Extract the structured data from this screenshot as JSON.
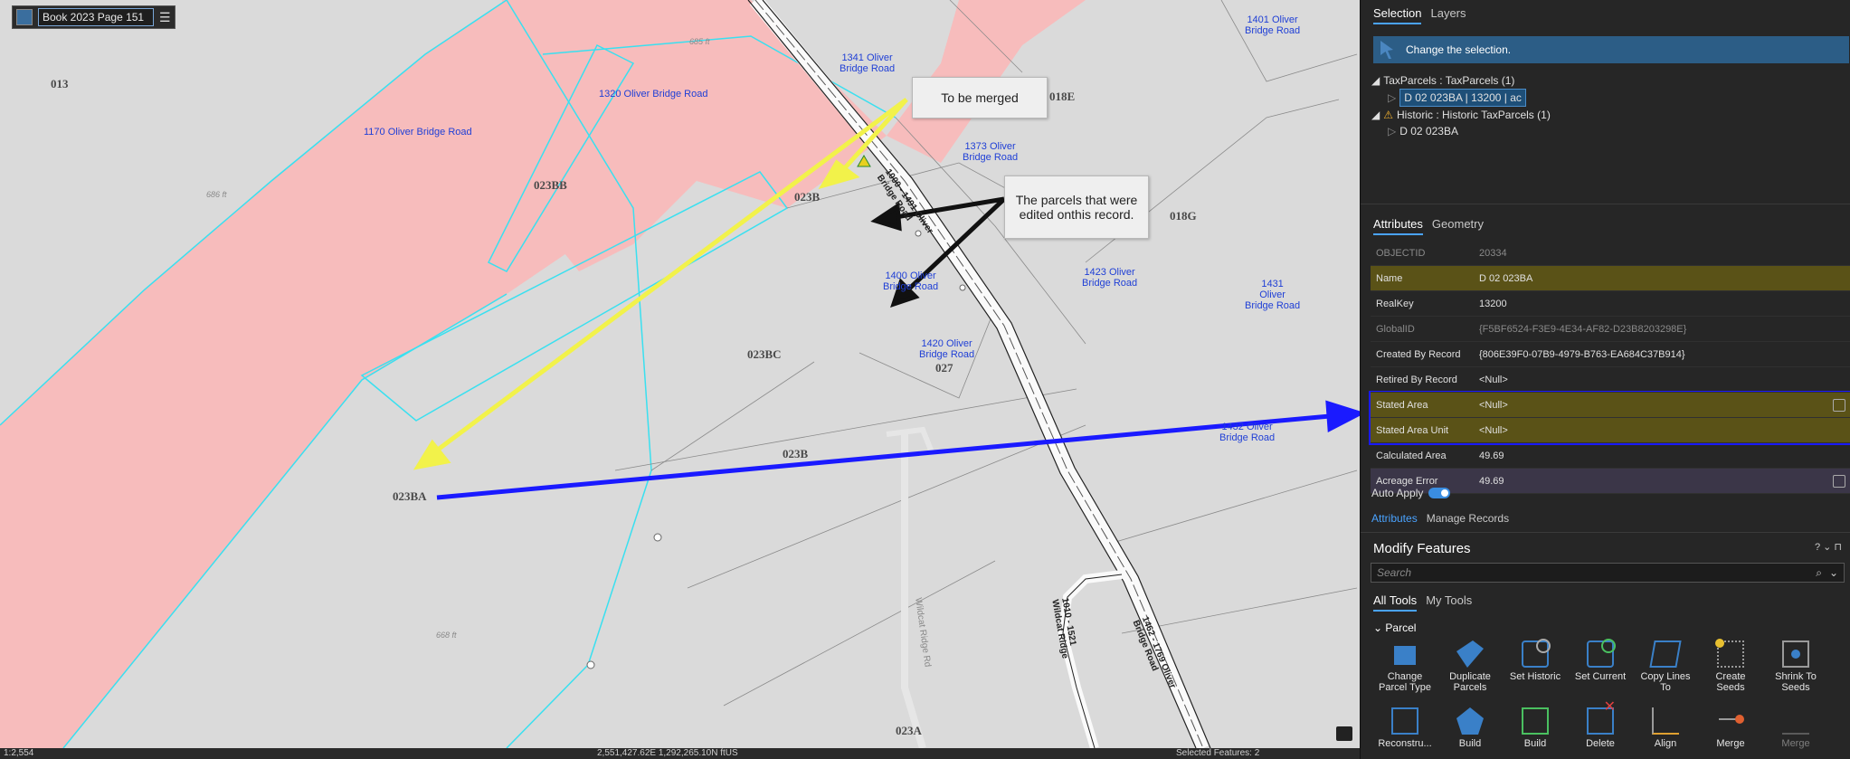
{
  "bookmark": {
    "label": "Book 2023 Page 151"
  },
  "map": {
    "callouts": {
      "merge": "To be merged",
      "edited": "The parcels that were edited onthis record."
    },
    "parcels": [
      "013",
      "023BB",
      "023B",
      "023BC",
      "023B",
      "023BA",
      "018E",
      "018G",
      "027",
      "023A"
    ],
    "addresses": {
      "a1170": "1170 Oliver Bridge Road",
      "a1320": "1320 Oliver Bridge Road",
      "a1341": "1341 Oliver\nBridge Road",
      "a1373": "1373 Oliver\nBridge Road",
      "a1401": "1401 Oliver\nBridge Road",
      "a1400": "1400 Oliver\nBridge Road",
      "a1420": "1420 Oliver\nBridge Road",
      "a1423": "1423 Oliver\nBridge Road",
      "a1431": "1431\nOliver\nBridge Road",
      "a1432": "1432 Oliver\nBridge Road"
    },
    "elevations": [
      "685 ft",
      "686 ft",
      "668 ft"
    ],
    "roads": {
      "r1": "1000 - 1491 Oliver\nBridge Road",
      "r2": "1462 - 1769 Oliver\nBridge Road",
      "r3": "1010 - 1521\nWildcat Ridge",
      "r4": "Wildcat Ridge Rd"
    }
  },
  "statusbar": {
    "scale": "1:2,554",
    "coords": "2,551,427.62E 1,292,265.10N ftUS",
    "selected": "Selected Features: 2"
  },
  "panel": {
    "top_tabs": [
      "Selection",
      "Layers"
    ],
    "selection_message": "Change the selection.",
    "tree": {
      "group1": "TaxParcels : TaxParcels (1)",
      "item1": "D 02  023BA | 13200 |  ac",
      "group2": "Historic : Historic TaxParcels (1)",
      "item2": "D 02  023BA"
    },
    "attr_tabs": [
      "Attributes",
      "Geometry"
    ],
    "attributes": [
      {
        "k": "OBJECTID",
        "v": "20334"
      },
      {
        "k": "Name",
        "v": "D 02  023BA"
      },
      {
        "k": "RealKey",
        "v": "13200"
      },
      {
        "k": "GlobalID",
        "v": "{F5BF6524-F3E9-4E34-AF82-D23B8203298E}"
      },
      {
        "k": "Created By Record",
        "v": "{806E39F0-07B9-4979-B763-EA684C37B914}"
      },
      {
        "k": "Retired By Record",
        "v": "<Null>"
      },
      {
        "k": "Stated Area",
        "v": "<Null>"
      },
      {
        "k": "Stated Area Unit",
        "v": "<Null>"
      },
      {
        "k": "Calculated Area",
        "v": "49.69"
      },
      {
        "k": "Acreage Error",
        "v": "49.69"
      }
    ],
    "auto_apply": "Auto Apply",
    "bottom_tabs": [
      "Attributes",
      "Manage Records"
    ],
    "modify": {
      "title": "Modify Features",
      "controls": "? ⌄ ⊓",
      "search_placeholder": "Search",
      "tabs": [
        "All Tools",
        "My Tools"
      ],
      "group": "Parcel",
      "tools_row1": [
        "Change\nParcel Type",
        "Duplicate\nParcels",
        "Set Historic",
        "Set Current",
        "Copy Lines\nTo",
        "Create\nSeeds",
        "Shrink To\nSeeds"
      ],
      "tools_row2": [
        "Reconstru...",
        "Build",
        "Build",
        "Delete",
        "Align",
        "Merge",
        "Merge"
      ]
    }
  },
  "colors": {
    "parcel_fill": "#f7b9b9",
    "parcel_line": "#39e0f0",
    "blue_highlight": "#1a1aff",
    "accent": "#4aa3ff"
  }
}
